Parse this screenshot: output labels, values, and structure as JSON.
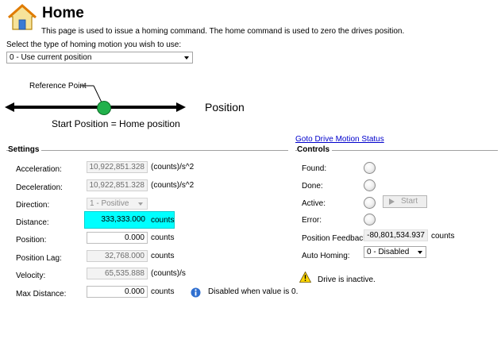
{
  "header": {
    "title": "Home",
    "description": "This page is used to issue a homing command. The home command is used to zero the drives position.",
    "home_icon": "house-icon"
  },
  "homing_type": {
    "label": "Select the type of homing motion you wish to use:",
    "selected": "0 - Use current position"
  },
  "diagram": {
    "reference_label": "Reference Point",
    "axis_label": "Position",
    "caption": "Start Position = Home position",
    "marker_color": "#22b14c"
  },
  "goto_link": "Goto Drive Motion Status",
  "settings": {
    "title": "Settings",
    "acceleration": {
      "label": "Acceleration:",
      "value": "10,922,851.328",
      "unit": "(counts)/s^2"
    },
    "deceleration": {
      "label": "Deceleration:",
      "value": "10,922,851.328",
      "unit": "(counts)/s^2"
    },
    "direction": {
      "label": "Direction:",
      "value": "1 - Positive"
    },
    "distance": {
      "label": "Distance:",
      "value": "333,333.000",
      "unit": "counts",
      "highlight_color": "#00ffff"
    },
    "position": {
      "label": "Position:",
      "value": "0.000",
      "unit": "counts"
    },
    "position_lag": {
      "label": "Position Lag:",
      "value": "32,768.000",
      "unit": "counts"
    },
    "velocity": {
      "label": "Velocity:",
      "value": "65,535.888",
      "unit": "(counts)/s"
    },
    "max_distance": {
      "label": "Max Distance:",
      "value": "0.000",
      "unit": "counts",
      "note": "Disabled when value is 0.",
      "note_icon": "info-icon"
    }
  },
  "controls": {
    "title": "Controls",
    "found_label": "Found:",
    "done_label": "Done:",
    "active_label": "Active:",
    "start_label": "Start",
    "error_label": "Error:",
    "position_feedback": {
      "label": "Position Feedback:",
      "value": "-80,801,534.937",
      "unit": "counts"
    },
    "auto_homing": {
      "label": "Auto Homing:",
      "value": "0 - Disabled"
    },
    "status_text": "Drive is inactive.",
    "status_icon": "warning-icon"
  }
}
